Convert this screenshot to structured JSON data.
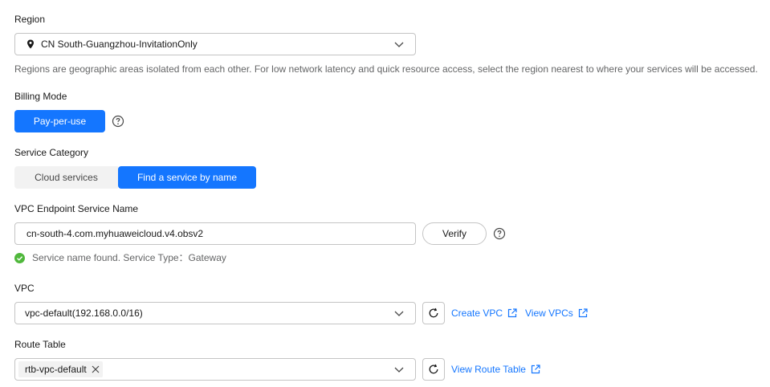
{
  "region": {
    "label": "Region",
    "selected": "CN South-Guangzhou-InvitationOnly",
    "hint": "Regions are geographic areas isolated from each other. For low network latency and quick resource access, select the region nearest to where your services will be accessed."
  },
  "billing": {
    "label": "Billing Mode",
    "option": "Pay-per-use"
  },
  "service_category": {
    "label": "Service Category",
    "options": [
      "Cloud services",
      "Find a service by name"
    ],
    "selected": "Find a service by name"
  },
  "endpoint_service": {
    "label": "VPC Endpoint Service Name",
    "value": "cn-south-4.com.myhuaweicloud.v4.obsv2",
    "verify_label": "Verify",
    "status": "Service name found. Service Type：Gateway"
  },
  "vpc": {
    "label": "VPC",
    "selected": "vpc-default(192.168.0.0/16)",
    "create_link": "Create VPC",
    "view_link": "View VPCs"
  },
  "route_table": {
    "label": "Route Table",
    "tag": "rtb-vpc-default",
    "view_link": "View Route Table"
  },
  "colors": {
    "primary": "#1476ff",
    "success": "#50b83c",
    "border": "#c4c4c4"
  }
}
